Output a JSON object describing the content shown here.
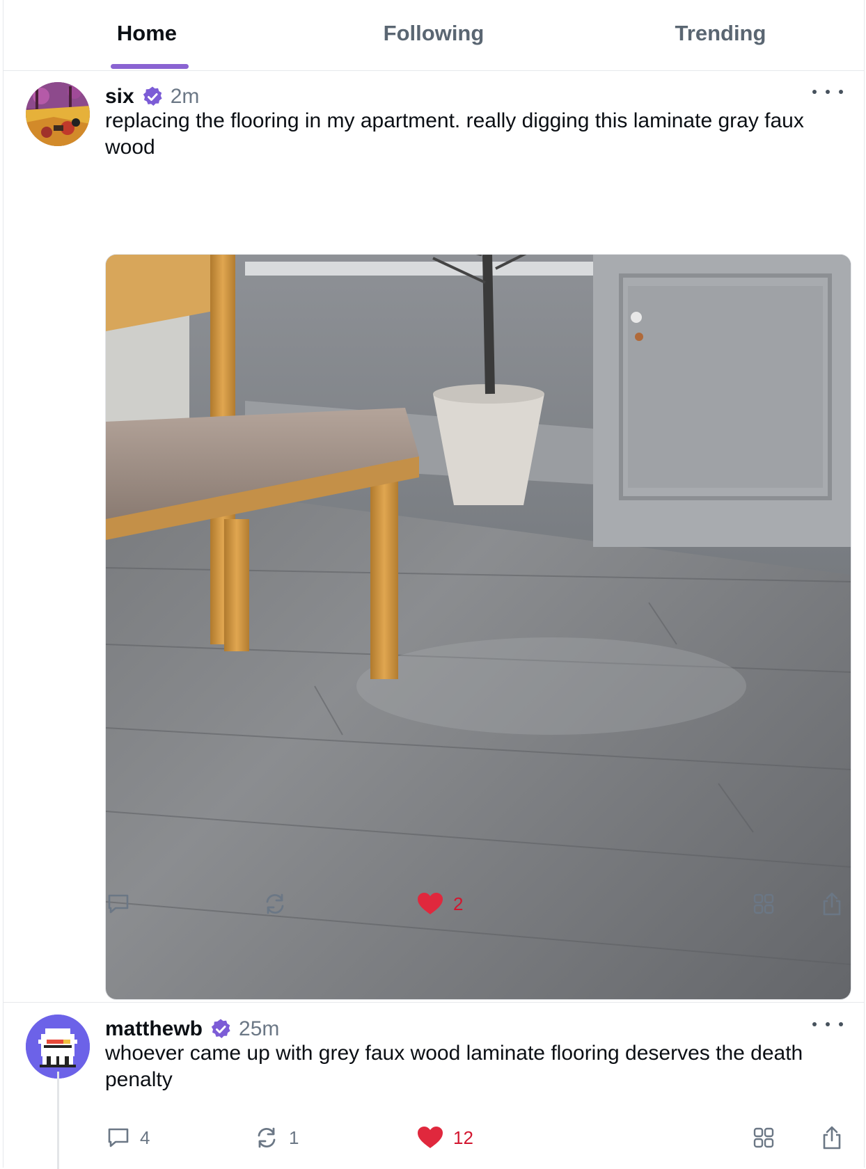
{
  "tabs": [
    {
      "label": "Home",
      "active": true
    },
    {
      "label": "Following",
      "active": false
    },
    {
      "label": "Trending",
      "active": false
    }
  ],
  "accent_color": "#8a63d2",
  "like_color": "#e0283d",
  "posts": [
    {
      "username": "six",
      "verified": true,
      "time": "2m",
      "text": "replacing the flooring in my apartment. really digging this laminate gray faux wood",
      "avatar": "autumn-landscape-avatar",
      "image": "gray-laminate-floor-photo",
      "stats": {
        "replies": "",
        "recasts": "",
        "likes": "2"
      },
      "liked": true
    },
    {
      "username": "matthewb",
      "verified": true,
      "time": "25m",
      "text": "whoever came up with grey faux wood laminate flooring deserves the death penalty",
      "avatar": "pixel-character-avatar",
      "stats": {
        "replies": "4",
        "recasts": "1",
        "likes": "12"
      },
      "liked": true
    }
  ],
  "icons": {
    "reply": "speech-bubble-icon",
    "recast": "recast-arrows-icon",
    "like": "heart-icon",
    "grid": "grid-icon",
    "share": "share-icon",
    "more": "more-dots-icon",
    "verified": "verified-badge-icon"
  }
}
